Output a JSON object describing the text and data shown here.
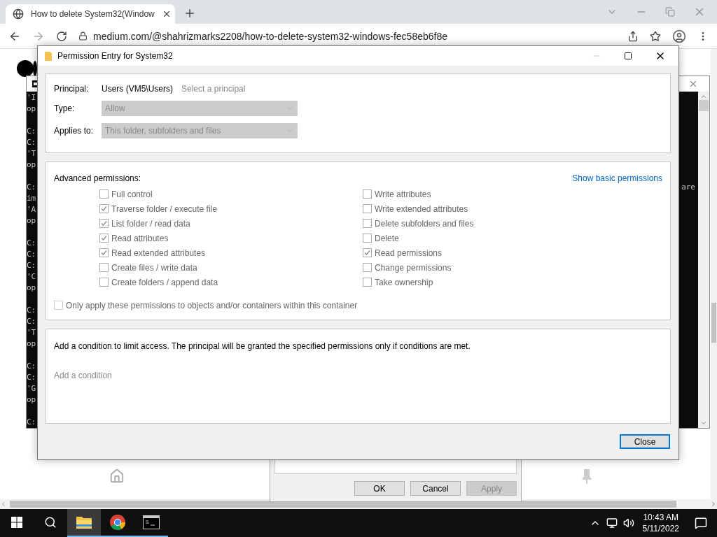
{
  "browser": {
    "tab": {
      "title": "How to delete System32(Window"
    },
    "url": "medium.com/@shahrizmarks2208/how-to-delete-system32-windows-fec58eb6f8e"
  },
  "console": {
    "blocks": [
      [
        {
          "text": "'I"
        },
        {
          "text": "op"
        }
      ],
      [
        {
          "text": "C:"
        },
        {
          "text": "C:"
        },
        {
          "text": "'T"
        },
        {
          "text": "op"
        }
      ],
      [
        {
          "text": "C:",
          "tail": "are"
        },
        {
          "text": "im"
        },
        {
          "text": "'A"
        },
        {
          "text": "op"
        }
      ],
      [
        {
          "text": "C:"
        },
        {
          "text": "C:"
        },
        {
          "text": "C:"
        },
        {
          "text": "'C"
        },
        {
          "text": "op"
        }
      ],
      [
        {
          "text": "C:"
        },
        {
          "text": "C:"
        },
        {
          "text": "'T"
        },
        {
          "text": "op"
        }
      ],
      [
        {
          "text": "C:"
        },
        {
          "text": "C:"
        },
        {
          "text": "'G"
        },
        {
          "text": "op"
        }
      ],
      [
        {
          "text": "C:"
        }
      ]
    ]
  },
  "dialog": {
    "title": "Permission Entry for System32",
    "principal": {
      "label": "Principal:",
      "value": "Users (VM5\\Users)",
      "link": "Select a principal"
    },
    "fields": [
      {
        "label": "Type:",
        "value": "Allow"
      },
      {
        "label": "Applies to:",
        "value": "This folder, subfolders and files"
      }
    ],
    "advanced": {
      "heading": "Advanced permissions:",
      "toggle_link": "Show basic permissions",
      "columns": [
        [
          {
            "label": "Full control",
            "checked": false
          },
          {
            "label": "Traverse folder / execute file",
            "checked": true
          },
          {
            "label": "List folder / read data",
            "checked": true
          },
          {
            "label": "Read attributes",
            "checked": true
          },
          {
            "label": "Read extended attributes",
            "checked": true
          },
          {
            "label": "Create files / write data",
            "checked": false
          },
          {
            "label": "Create folders / append data",
            "checked": false
          }
        ],
        [
          {
            "label": "Write attributes",
            "checked": false
          },
          {
            "label": "Write extended attributes",
            "checked": false
          },
          {
            "label": "Delete subfolders and files",
            "checked": false
          },
          {
            "label": "Delete",
            "checked": false
          },
          {
            "label": "Read permissions",
            "checked": true
          },
          {
            "label": "Change permissions",
            "checked": false
          },
          {
            "label": "Take ownership",
            "checked": false
          }
        ]
      ]
    },
    "only_apply": {
      "label": "Only apply these permissions to objects and/or containers within this container",
      "checked": false
    },
    "condition": {
      "text": "Add a condition to limit access. The principal will be granted the specified permissions only if conditions are met.",
      "link": "Add a condition"
    },
    "close_button": "Close"
  },
  "back_dialog": {
    "buttons": [
      {
        "label": "OK",
        "disabled": false
      },
      {
        "label": "Cancel",
        "disabled": false
      },
      {
        "label": "Apply",
        "disabled": true
      }
    ]
  },
  "taskbar": {
    "apps": [
      {
        "kind": "explorer",
        "active": true
      },
      {
        "kind": "chrome",
        "active": false
      },
      {
        "kind": "terminal",
        "active": false
      }
    ],
    "time": "10:43 AM",
    "date": "5/11/2022"
  }
}
